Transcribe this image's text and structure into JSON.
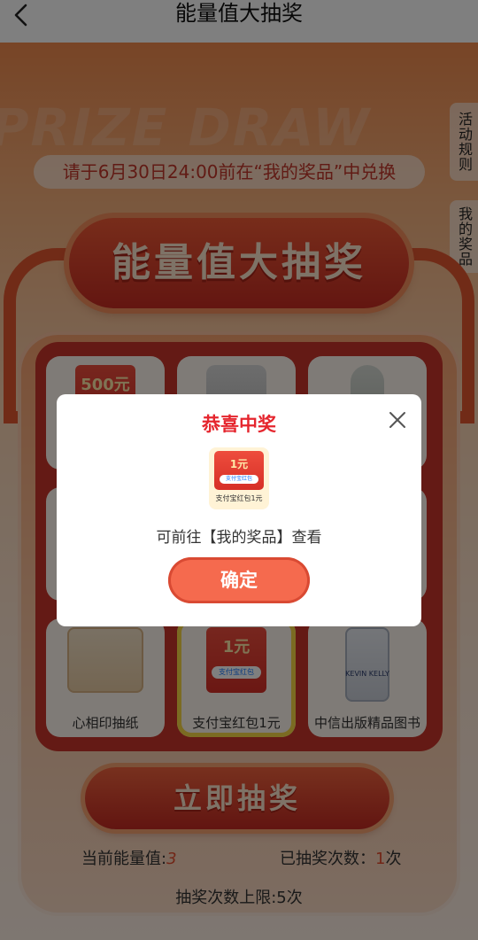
{
  "header": {
    "title": "能量值大抽奖"
  },
  "notice": "请于6月30日24:00前在“我的奖品”中兑换",
  "side_tabs": [
    "活动规则",
    "我的奖品"
  ],
  "banner_title": "能量值大抽奖",
  "prizes": [
    {
      "label": "",
      "badge": "500元"
    },
    {
      "label": ""
    },
    {
      "label": ""
    },
    {
      "label": "心相印抽纸"
    },
    {
      "label": "支付宝红包1元",
      "badge": "1元",
      "brand": "支付宝红包"
    },
    {
      "label": "中信出版精品图书",
      "cover_text": "KEVIN KELLY"
    }
  ],
  "draw_button": "立即抽奖",
  "stats": {
    "energy_label": "当前能量值:",
    "energy_value": "3",
    "draws_label": "已抽奖次数：",
    "draws_value": "1",
    "draws_unit": "次"
  },
  "limit_text": "抽奖次数上限:5次",
  "modal": {
    "title": "恭喜中奖",
    "prize_amount": "1元",
    "prize_brand": "支付宝红包",
    "prize_label": "支付宝红包1元",
    "hint": "可前往【我的奖品】查看",
    "confirm": "确定"
  },
  "colors": {
    "accent": "#e5262e",
    "button": "#f56a4e",
    "stage": "#f5b07c"
  }
}
